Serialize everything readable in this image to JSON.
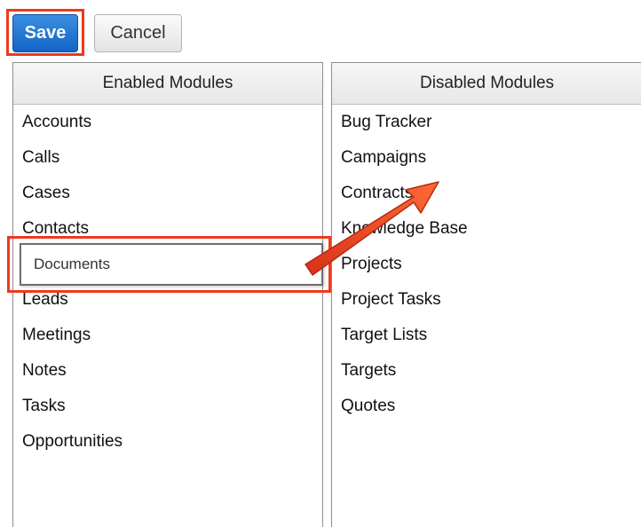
{
  "toolbar": {
    "save_label": "Save",
    "cancel_label": "Cancel"
  },
  "enabled_panel": {
    "header": "Enabled Modules",
    "items": [
      "Accounts",
      "Calls",
      "Cases",
      "Contacts",
      "Leads",
      "Meetings",
      "Notes",
      "Tasks",
      "Opportunities"
    ]
  },
  "dragged_item": {
    "label": "Documents"
  },
  "disabled_panel": {
    "header": "Disabled Modules",
    "items": [
      "Bug Tracker",
      "Campaigns",
      "Contracts",
      "Knowledge Base",
      "Projects",
      "Project Tasks",
      "Target Lists",
      "Targets",
      "Quotes"
    ]
  },
  "colors": {
    "highlight": "#ee3a1c",
    "save_button": "#1f6fd0",
    "arrow": "#f04a1f"
  },
  "icons": {
    "drag_arrow": "arrow-icon"
  }
}
